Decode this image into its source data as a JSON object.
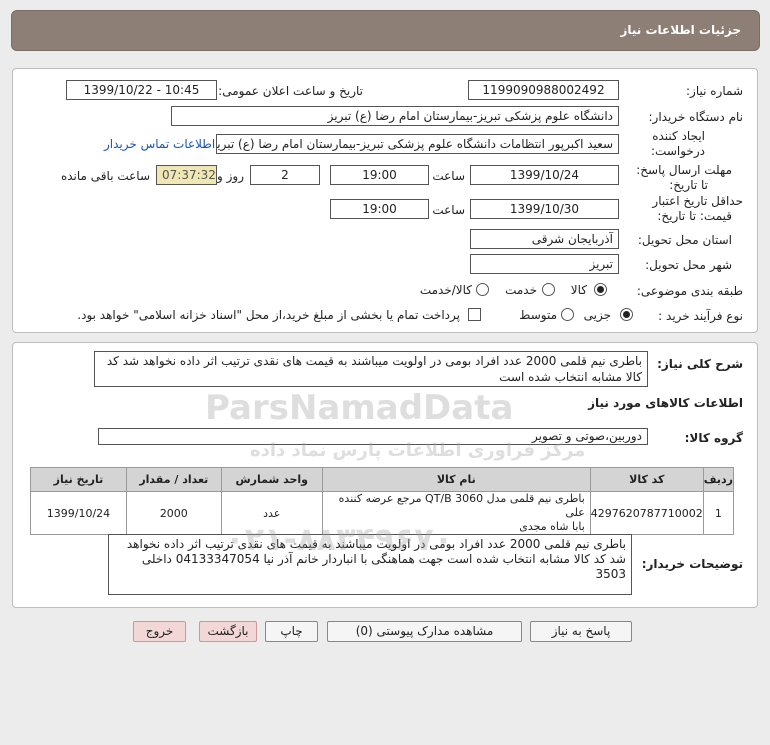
{
  "header": {
    "title": "جزئیات اطلاعات نیاز"
  },
  "details": {
    "need_number_label": "شماره نیاز:",
    "need_number": "1199090988002492",
    "announce_label": "تاریخ و ساعت اعلان عمومی:",
    "announce_value": "1399/10/22 - 10:45",
    "buyer_org_label": "نام دستگاه خریدار:",
    "buyer_org": "دانشگاه علوم پزشکی تبریز-بیمارستان امام رضا (ع) تبریز",
    "creator_label_1": "ایجاد کننده",
    "creator_label_2": "درخواست:",
    "creator": "سعید اکبرپور انتظامات دانشگاه علوم پزشکی تبریز-بیمارستان امام رضا (ع) تبریز",
    "contact_link": "اطلاعات تماس خریدار",
    "reply_label_1": "مهلت ارسال پاسخ:",
    "reply_label_2": "تا تاریخ:",
    "reply_date": "1399/10/24",
    "time_label": "ساعت",
    "reply_time": "19:00",
    "days_value": "2",
    "days_label": "روز و",
    "remaining_time": "07:37:32",
    "remaining_label": "ساعت باقی مانده",
    "validity_label_1": "حداقل تاریخ اعتبار",
    "validity_label_2": "قیمت: تا تاریخ:",
    "validity_date": "1399/10/30",
    "validity_time": "19:00",
    "province_label": "استان محل تحویل:",
    "province": "آذربایجان شرقی",
    "city_label": "شهر محل تحویل:",
    "city": "تبریز",
    "category_label": "طبقه بندی موضوعی:",
    "category_options": [
      "کالا",
      "خدمت",
      "کالا/خدمت"
    ],
    "process_label": "نوع فرآیند خرید :",
    "process_options": [
      "جزیی",
      "متوسط"
    ],
    "payment_note": "پرداخت تمام یا بخشی از مبلغ خرید،از محل \"اسناد خزانه اسلامی\" خواهد بود."
  },
  "description": {
    "label": "شرح کلی نیاز:",
    "text": "باطری نیم قلمی 2000 عدد افراد بومی در اولویت میباشند به قیمت های نقدی ترتیب اثر داده نخواهد شد کد کالا مشابه انتخاب شده است"
  },
  "goods": {
    "section_title": "اطلاعات کالاهای مورد نیاز",
    "group_label": "گروه کالا:",
    "group_value": "دوربین،صوتی و تصویر",
    "columns": [
      "ردیف",
      "کد کالا",
      "نام کالا",
      "واحد شمارش",
      "تعداد / مقدار",
      "تاریخ نیاز"
    ],
    "rows": [
      {
        "index": "1",
        "code": "4297620787710002",
        "name_line1": "باطری نیم قلمی مدل QT/B 3060 مرجع عرضه کننده علی",
        "name_line2": "بابا شاه مجدی",
        "unit": "عدد",
        "qty": "2000",
        "date": "1399/10/24"
      }
    ]
  },
  "buyer_notes": {
    "label": "توضیحات خریدار:",
    "text": "باطری نیم قلمی 2000 عدد افراد بومی در اولویت میباشند به قیمت های نقدی ترتیب اثر داده نخواهد شد کد کالا مشابه انتخاب شده است جهت هماهنگی با انباردار خانم آذر نیا 04133347054 داخلی 3503"
  },
  "buttons": {
    "reply": "پاسخ به نیاز",
    "docs": "مشاهده مدارک پیوستی (0)",
    "print": "چاپ",
    "back": "بازگشت",
    "exit": "خروج"
  },
  "watermarks": [
    "ParsNamadData",
    "مرکز فراوری اطلاعات پارس نماد داده",
    "۰۲۱-۸۸۳۴۹۶۷۰"
  ]
}
